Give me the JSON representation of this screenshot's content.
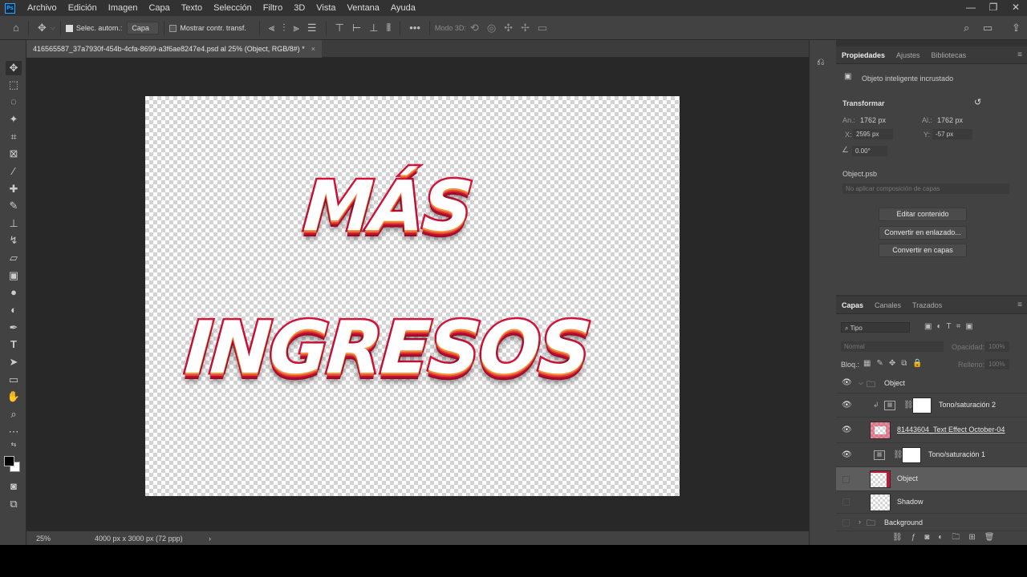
{
  "app": {
    "logo": "Ps"
  },
  "menu": [
    "Archivo",
    "Edición",
    "Imagen",
    "Capa",
    "Texto",
    "Selección",
    "Filtro",
    "3D",
    "Vista",
    "Ventana",
    "Ayuda"
  ],
  "window_controls": [
    "—",
    "❐",
    "✕"
  ],
  "options_bar": {
    "auto_select_label": "Selec. autom.:",
    "auto_select_value": "Capa",
    "show_transform_label": "Mostrar contr. transf.",
    "more": "•••",
    "mode3d": "Modo 3D:"
  },
  "document": {
    "tab_title": "416565587_37a7930f-454b-4cfa-8699-a3f6ae8247e4.psd al 25% (Object, RGB/8#) *",
    "close": "×",
    "zoom": "25%",
    "doc_size": "4000 px x 3000 px (72 ppp)",
    "status_arrow": "›",
    "canvas_text": {
      "line1": "MÁS",
      "line2": "INGRESOS"
    },
    "effect_colors": {
      "stroke": "#d3133a",
      "inner": "#f6913a",
      "depth": "#a00a2a"
    }
  },
  "properties_panel": {
    "tabs": [
      "Propiedades",
      "Ajustes",
      "Bibliotecas"
    ],
    "object_type": "Objeto inteligente incrustado",
    "transform_heading": "Transformar",
    "width_label": "An.:",
    "width_value": "1762 px",
    "height_label": "Al.:",
    "height_value": "1762 px",
    "x_label": "X:",
    "x_value": "2595 px",
    "y_label": "Y:",
    "y_value": "-57 px",
    "angle_value": "0.00°",
    "file_name": "Object.psb",
    "comp_placeholder": "No aplicar composición de capas",
    "buttons": [
      "Editar contenido",
      "Convertir en enlazado...",
      "Convertir en capas"
    ]
  },
  "layers_panel": {
    "tabs": [
      "Capas",
      "Canales",
      "Trazados"
    ],
    "filter_label": "Tipo",
    "blend_mode": "Normal",
    "opacity_label": "Opacidad:",
    "opacity_value": "100%",
    "lock_label": "Bloq.:",
    "fill_label": "Relleno:",
    "fill_value": "100%",
    "layers": [
      {
        "name": "Object",
        "kind": "group",
        "visible": true
      },
      {
        "name": "Tono/saturación 2",
        "kind": "adjustment",
        "visible": true
      },
      {
        "name": "81443604_Text Effect October-04",
        "kind": "smart",
        "visible": true
      },
      {
        "name": "Tono/saturación 1",
        "kind": "adjustment",
        "visible": true
      },
      {
        "name": "Object",
        "kind": "smart",
        "visible": false,
        "selected": true
      },
      {
        "name": "Shadow",
        "kind": "pixel",
        "visible": false
      },
      {
        "name": "Background",
        "kind": "group",
        "visible": false
      }
    ]
  }
}
